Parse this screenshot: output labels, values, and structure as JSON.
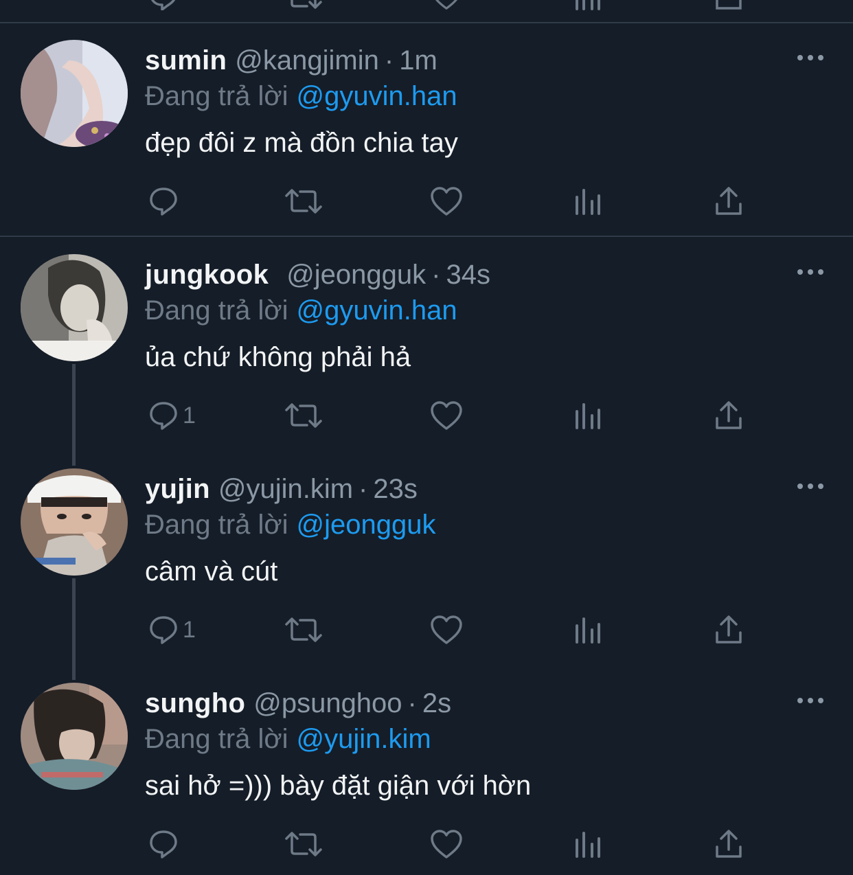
{
  "colors": {
    "background": "#151d28",
    "divider": "#2f3b48",
    "name": "#f2f4f5",
    "secondary": "#8b98a5",
    "mention": "#1d9bf0",
    "icon": "#6e7a87"
  },
  "icons": [
    "reply-icon",
    "retweet-icon",
    "like-icon",
    "analytics-icon",
    "share-icon",
    "more-icon"
  ],
  "tweets": [
    {
      "name": "sumin",
      "handle": "@kangjimin",
      "separator": "·",
      "time": "1m",
      "reply_prefix": "Đang trả lời",
      "reply_to": "@gyuvin.han",
      "text": "đẹp đôi z mà đồn chia tay",
      "reply_count": ""
    },
    {
      "name": "jungkook",
      "handle": "@jeongguk",
      "separator": "·",
      "time": "34s",
      "reply_prefix": "Đang trả lời",
      "reply_to": "@gyuvin.han",
      "text": "ủa chứ không phải hả",
      "reply_count": "1"
    },
    {
      "name": "yujin",
      "handle": "@yujin.kim",
      "separator": "·",
      "time": "23s",
      "reply_prefix": "Đang trả lời",
      "reply_to": "@jeongguk",
      "text": "câm và cút",
      "reply_count": "1"
    },
    {
      "name": "sungho",
      "handle": "@psunghoo",
      "separator": "·",
      "time": "2s",
      "reply_prefix": "Đang trả lời",
      "reply_to": "@yujin.kim",
      "text": "sai hở =))) bày đặt giận với hờn",
      "reply_count": ""
    }
  ]
}
